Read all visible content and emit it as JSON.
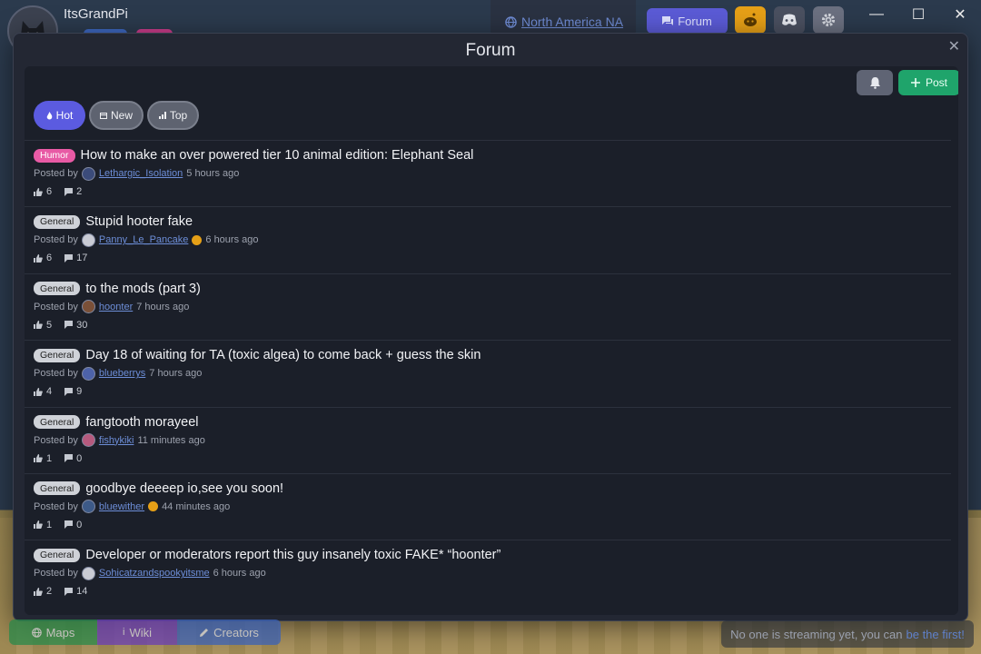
{
  "app": {
    "username": "ItsGrandPi",
    "region": "North America NA",
    "forum_tab": "Forum"
  },
  "window": {
    "minimize": "—",
    "maximize": "☐",
    "close": "✕"
  },
  "modal": {
    "title": "Forum",
    "close": "✕",
    "post_button": "Post",
    "sort": {
      "hot": "Hot",
      "new": "New",
      "top": "Top"
    }
  },
  "posts": [
    {
      "tag": "Humor",
      "title": "How to make an over powered tier 10 animal edition: Elephant Seal",
      "posted_by": "Posted by",
      "author": "Lethargic_Isolation",
      "time": "5 hours ago",
      "likes": "6",
      "comments": "2",
      "avatar_color": "#3b4b7a"
    },
    {
      "tag": "General",
      "title": "Stupid hooter fake",
      "posted_by": "Posted by",
      "author": "Panny_Le_Pancake",
      "time": "6 hours ago",
      "likes": "6",
      "comments": "17",
      "avatar_color": "#c9cbd4"
    },
    {
      "tag": "General",
      "title": "to the mods (part 3)",
      "posted_by": "Posted by",
      "author": "hoonter",
      "time": "7 hours ago",
      "likes": "5",
      "comments": "30",
      "avatar_color": "#7a5038"
    },
    {
      "tag": "General",
      "title": "Day 18 of waiting for TA (toxic algea) to come back + guess the skin",
      "posted_by": "Posted by",
      "author": "blueberrys",
      "time": "7 hours ago",
      "likes": "4",
      "comments": "9",
      "avatar_color": "#4d62a8"
    },
    {
      "tag": "General",
      "title": "fangtooth morayeel",
      "posted_by": "Posted by",
      "author": "fishykiki",
      "time": "11 minutes ago",
      "likes": "1",
      "comments": "0",
      "avatar_color": "#b65a7e"
    },
    {
      "tag": "General",
      "title": "goodbye deeeep io,see you soon!",
      "posted_by": "Posted by",
      "author": "bluewither",
      "time": "44 minutes ago",
      "likes": "1",
      "comments": "0",
      "avatar_color": "#3d5a88"
    },
    {
      "tag": "General",
      "title": "Developer or moderators report this guy insanely toxic FAKE* “hoonter”",
      "posted_by": "Posted by",
      "author": "Sohicatzandspookyitsme",
      "time": "6 hours ago",
      "likes": "2",
      "comments": "14",
      "avatar_color": "#c9cbd4"
    }
  ],
  "bottom": {
    "maps": "Maps",
    "wiki": "Wiki",
    "creators": "Creators",
    "stream_text": "No one is streaming yet, you can",
    "stream_link": "be the first!"
  }
}
